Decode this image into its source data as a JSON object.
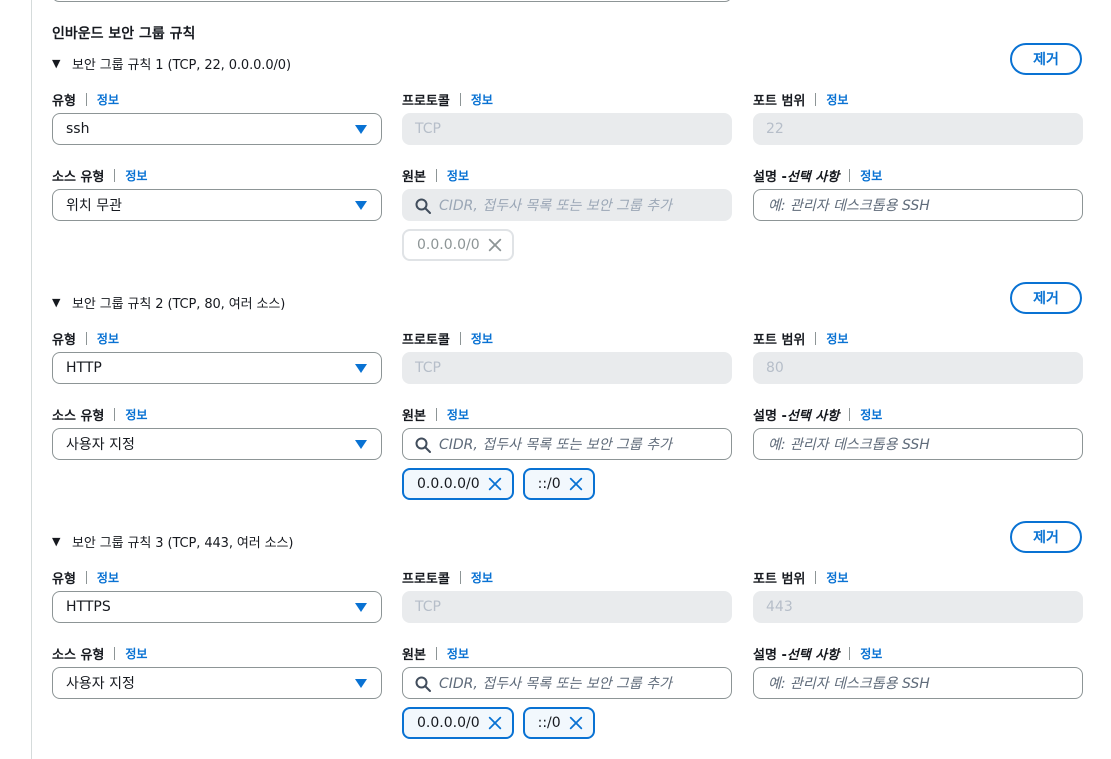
{
  "section_title": "인바운드 보안 그룹 규칙",
  "labels": {
    "type": "유형",
    "protocol": "프로토콜",
    "port_range": "포트 범위",
    "source_type": "소스 유형",
    "source": "원본",
    "description_prefix": "설명 - ",
    "description_optional": "선택 사항",
    "info": "정보",
    "remove": "제거",
    "source_placeholder": "CIDR, 접두사 목록 또는 보안 그룹 추가",
    "description_placeholder": "예: 관리자 데스크톱용 SSH"
  },
  "rules": [
    {
      "title": "보안 그룹 규칙 1",
      "subtitle": "(TCP, 22, 0.0.0.0/0)",
      "type": "ssh",
      "protocol": "TCP",
      "port_range": "22",
      "source_type": "위치 무관",
      "source_disabled": true,
      "tokens": [
        "0.0.0.0/0"
      ]
    },
    {
      "title": "보안 그룹 규칙 2",
      "subtitle": "(TCP, 80, 여러 소스)",
      "type": "HTTP",
      "protocol": "TCP",
      "port_range": "80",
      "source_type": "사용자 지정",
      "source_disabled": false,
      "tokens": [
        "0.0.0.0/0",
        "::/0"
      ]
    },
    {
      "title": "보안 그룹 규칙 3",
      "subtitle": "(TCP, 443, 여러 소스)",
      "type": "HTTPS",
      "protocol": "TCP",
      "port_range": "443",
      "source_type": "사용자 지정",
      "source_disabled": false,
      "tokens": [
        "0.0.0.0/0",
        "::/0"
      ]
    }
  ],
  "colors": {
    "accent": "#0972d3",
    "disabled_bg": "#e9ebed",
    "border": "#8d9596",
    "text": "#16191f"
  },
  "icons": {
    "caret": "caret-down-icon",
    "dropdown": "dropdown-arrow-icon",
    "search": "search-icon",
    "dismiss": "close-icon"
  }
}
